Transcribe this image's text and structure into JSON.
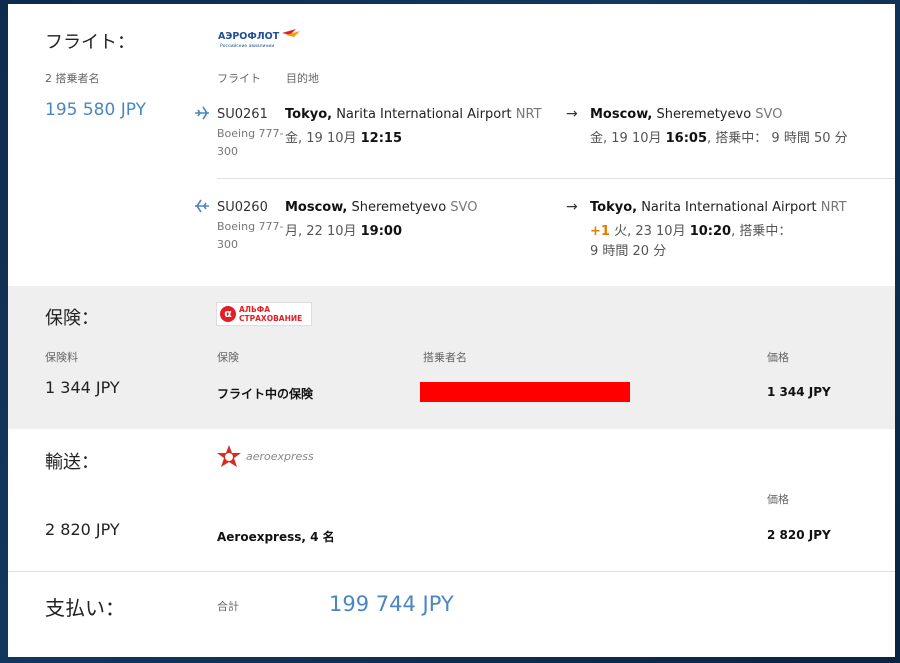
{
  "flight": {
    "title": "フライト：",
    "airline_logo_text": "АЭРОФЛОТ",
    "airline_logo_sub": "Российские авиалинии",
    "passengers_label": "2 搭乗者名",
    "total_price": "195 580 JPY",
    "col_flight": "フライト",
    "col_destination": "目的地",
    "segments": [
      {
        "flight_no": "SU0261",
        "dep_city": "Tokyo,",
        "dep_airport": "Narita International Airport",
        "dep_code": "NRT",
        "aircraft": "Boeing 777-300",
        "aircraft_line1": "Boeing 777-",
        "aircraft_line2": "300",
        "dep_date": "金, 19 10月",
        "dep_time": "12:15",
        "arr_city": "Moscow,",
        "arr_airport": "Sheremetyevo",
        "arr_code": "SVO",
        "arr_date": "金, 19 10月",
        "arr_time": "16:05",
        "duration": ", 搭乗中： 9 時間 50 分"
      },
      {
        "flight_no": "SU0260",
        "dep_city": "Moscow,",
        "dep_airport": "Sheremetyevo",
        "dep_code": "SVO",
        "aircraft_line1": "Boeing 777-",
        "aircraft_line2": "300",
        "dep_date": "月, 22 10月",
        "dep_time": "19:00",
        "arr_city": "Tokyo,",
        "arr_airport": "Narita International Airport",
        "arr_code": "NRT",
        "arr_plus": "+1",
        "arr_date": "火, 23 10月",
        "arr_time": "10:20",
        "duration_line1": ", 搭乗中：",
        "duration_line2": "9 時間 20 分"
      }
    ]
  },
  "insurance": {
    "title": "保険：",
    "logo_letter": "α",
    "logo_line1": "АЛЬФА",
    "logo_line2": "СТРАХОВАНИЕ",
    "fee_label": "保険料",
    "fee": "1 344 JPY",
    "col_insurance": "保険",
    "col_passenger": "搭乗者名",
    "col_price": "価格",
    "item": "フライト中の保険",
    "price": "1 344 JPY"
  },
  "transport": {
    "title": "輸送：",
    "logo_text": "aeroexpress",
    "price_total": "2 820 JPY",
    "col_price": "価格",
    "item": "Aeroexpress, 4 名",
    "price": "2 820 JPY"
  },
  "payment": {
    "title": "支払い：",
    "total_label": "合計",
    "total": "199 744 JPY"
  },
  "colors": {
    "accent_blue": "#4a86c2",
    "plus_orange": "#e07b00",
    "redaction": "#ff0000"
  }
}
